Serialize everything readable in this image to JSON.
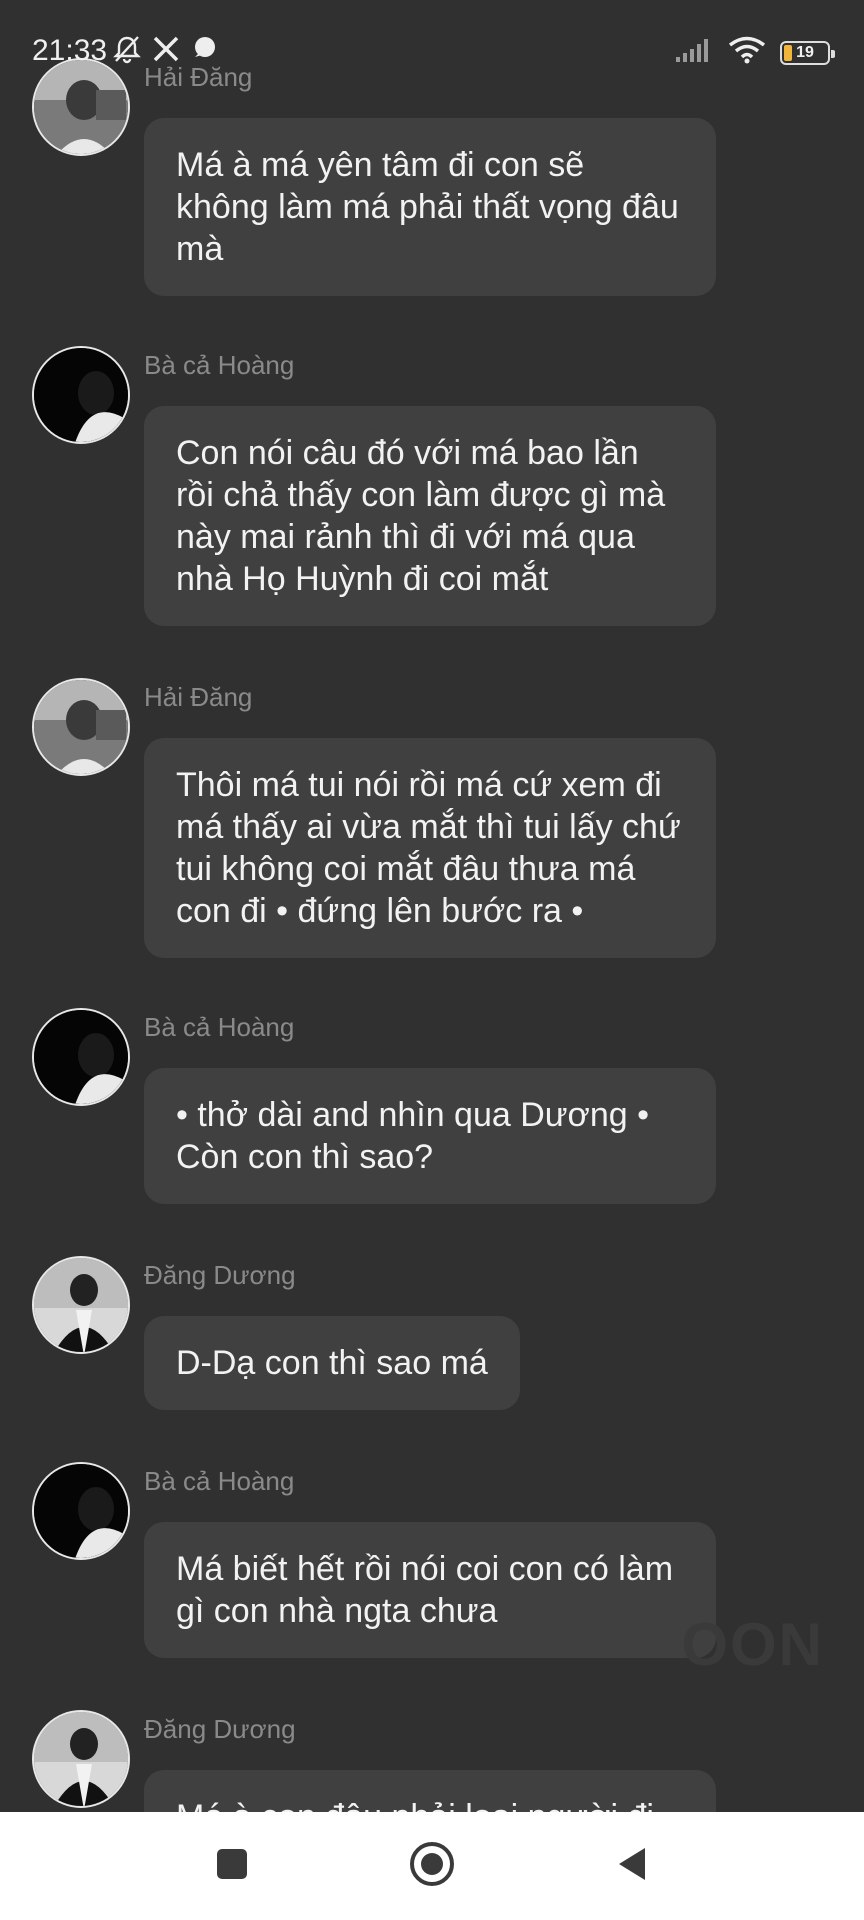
{
  "status_bar": {
    "time": "21:33",
    "battery_level": "19",
    "icons_left": [
      "mute-bell-icon",
      "x-app-icon",
      "chat-bubble-icon"
    ],
    "icons_right": [
      "signal-icon",
      "wifi-icon",
      "battery-icon"
    ]
  },
  "messages": [
    {
      "sender": "Hải Đăng",
      "text": "Má à má yên tâm đi con sẽ không làm má phải thất vọng đâu mà"
    },
    {
      "sender": "Bà cả Hoàng",
      "text": "Con nói câu đó với má bao lần rồi chả thấy con làm được gì mà này mai rảnh thì đi với má qua nhà Họ Huỳnh đi coi mắt"
    },
    {
      "sender": "Hải Đăng",
      "text": "Thôi má tui nói rồi má cứ xem đi má thấy ai vừa mắt thì tui lấy chứ tui không coi mắt đâu thưa má con đi • đứng lên bước ra •"
    },
    {
      "sender": "Bà cả Hoàng",
      "text": "• thở dài and nhìn qua Dương • Còn con thì sao?"
    },
    {
      "sender": "Đăng Dương",
      "text": "D-Dạ con thì sao má"
    },
    {
      "sender": "Bà cả Hoàng",
      "text": "Má biết hết rồi nói coi con có làm gì con nhà ngta chưa"
    },
    {
      "sender": "Đăng Dương",
      "text": "Má à con đâu phải loại người đi"
    }
  ],
  "watermark": "OON",
  "nav": {
    "buttons": [
      "recent-apps",
      "home",
      "back"
    ]
  }
}
